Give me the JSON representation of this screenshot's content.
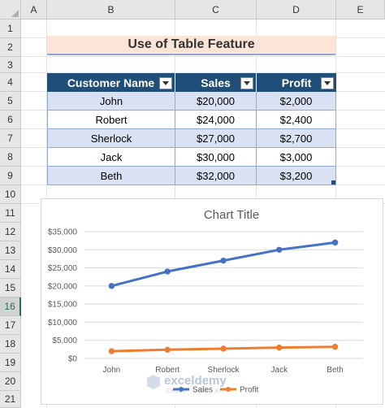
{
  "sheet": {
    "columns": [
      "A",
      "B",
      "C",
      "D",
      "E"
    ],
    "rows": [
      "1",
      "2",
      "3",
      "4",
      "5",
      "6",
      "7",
      "8",
      "9",
      "10",
      "11",
      "12",
      "13",
      "14",
      "15",
      "16",
      "17",
      "18",
      "19",
      "20",
      "21"
    ],
    "selected_row": "16"
  },
  "title": "Use of Table Feature",
  "table": {
    "headers": [
      "Customer Name",
      "Sales",
      "Profit"
    ],
    "rows": [
      [
        "John",
        "$20,000",
        "$2,000"
      ],
      [
        "Robert",
        "$24,000",
        "$2,400"
      ],
      [
        "Sherlock",
        "$27,000",
        "$2,700"
      ],
      [
        "Jack",
        "$30,000",
        "$3,000"
      ],
      [
        "Beth",
        "$32,000",
        "$3,200"
      ]
    ]
  },
  "watermark": {
    "name": "exceldemy",
    "tagline": "EXCEL · DATA · BI"
  },
  "colors": {
    "sales": "#4472c4",
    "profit": "#ed7d31",
    "header_fill": "#1f4e79",
    "band_fill": "#d9e1f2",
    "title_fill": "#fce4d6"
  },
  "chart_data": {
    "type": "line",
    "title": "Chart Title",
    "categories": [
      "John",
      "Robert",
      "Sherlock",
      "Jack",
      "Beth"
    ],
    "series": [
      {
        "name": "Sales",
        "values": [
          20000,
          24000,
          27000,
          30000,
          32000
        ]
      },
      {
        "name": "Profit",
        "values": [
          2000,
          2400,
          2700,
          3000,
          3200
        ]
      }
    ],
    "ylim": [
      0,
      35000
    ],
    "yticks": [
      "$0",
      "$5,000",
      "$10,000",
      "$15,000",
      "$20,000",
      "$25,000",
      "$30,000",
      "$35,000"
    ],
    "grid": true,
    "legend": "bottom"
  }
}
